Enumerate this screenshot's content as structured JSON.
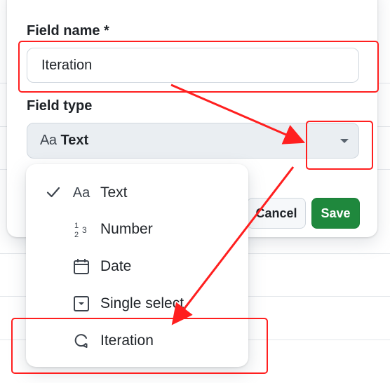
{
  "dialog": {
    "field_name_label": "Field name *",
    "field_name_value": "Iteration",
    "field_type_label": "Field type",
    "field_type_icon": "Aa",
    "field_type_value": "Text",
    "cancel_label": "Cancel",
    "save_label": "Save"
  },
  "menu": {
    "items": [
      {
        "label": "Text",
        "icon": "text-icon",
        "icon_text": "Aa",
        "selected": true
      },
      {
        "label": "Number",
        "icon": "number-icon",
        "selected": false
      },
      {
        "label": "Date",
        "icon": "calendar-icon",
        "selected": false
      },
      {
        "label": "Single select",
        "icon": "single-select-icon",
        "selected": false
      },
      {
        "label": "Iteration",
        "icon": "iteration-icon",
        "selected": false
      }
    ]
  },
  "colors": {
    "annotation": "#ff1f1f",
    "save_button": "#1f883d",
    "select_background": "#eaeef2"
  }
}
